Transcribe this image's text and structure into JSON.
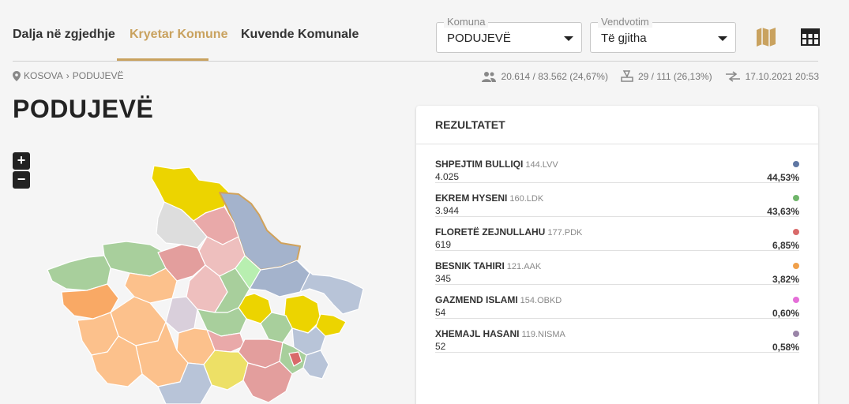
{
  "nav": {
    "tabs": [
      {
        "label": "Dalja në zgjedhje"
      },
      {
        "label": "Kryetar Komune"
      },
      {
        "label": "Kuvende Komunale"
      }
    ]
  },
  "filters": {
    "komuna": {
      "label": "Komuna",
      "value": "PODUJEVË"
    },
    "vendvotim": {
      "label": "Vendvotim",
      "value": "Të gjitha"
    }
  },
  "breadcrumb": {
    "root": "KOSOVA",
    "current": "PODUJEVË"
  },
  "stats": {
    "turnout": "20.614 / 83.562 (24,67%)",
    "stations": "29 / 111 (26,13%)",
    "updated": "17.10.2021 20:53"
  },
  "page": {
    "title": "PODUJEVË"
  },
  "zoom": {
    "in": "+",
    "out": "−"
  },
  "results": {
    "title": "REZULTATET",
    "candidates": [
      {
        "name": "SHPEJTIM BULLIQI",
        "party": "144.LVV",
        "votes": "4.025",
        "pct": "44,53%",
        "color": "#5f77a3"
      },
      {
        "name": "EKREM HYSENI",
        "party": "160.LDK",
        "votes": "3.944",
        "pct": "43,63%",
        "color": "#6fb56a"
      },
      {
        "name": "FLORETË ZEJNULLAHU",
        "party": "177.PDK",
        "votes": "619",
        "pct": "6,85%",
        "color": "#d96a6a"
      },
      {
        "name": "BESNIK TAHIRI",
        "party": "121.AAK",
        "votes": "345",
        "pct": "3,82%",
        "color": "#f0a04b"
      },
      {
        "name": "GAZMEND ISLAMI",
        "party": "154.OBKD",
        "votes": "54",
        "pct": "0,60%",
        "color": "#e56fd8"
      },
      {
        "name": "XHEMAJL HASANI",
        "party": "119.NISMA",
        "votes": "52",
        "pct": "0,58%",
        "color": "#9a85a8"
      }
    ]
  },
  "colors": {
    "accent": "#c9a25f"
  }
}
